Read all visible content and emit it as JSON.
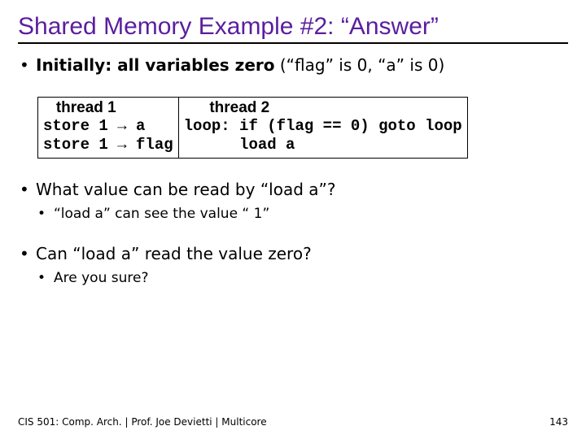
{
  "title": "Shared Memory Example #2: “Answer”",
  "bullets": {
    "b1_prefix_bold": "Initially: all variables zero",
    "b1_suffix": " (“flag” is 0, “a” is 0)",
    "b2": "What value can be read by “load a”?",
    "b2_sub": "“load a” can see the value “ 1”",
    "b3": "Can “load a” read the value zero?",
    "b3_sub": "Are you sure?"
  },
  "code": {
    "t1_head": "   thread 1",
    "t1_body": "store 1 → a\nstore 1 → flag",
    "t2_head": "      thread 2",
    "t2_body": "loop: if (flag == 0) goto loop\n      load a"
  },
  "footer": {
    "left": "CIS 501: Comp. Arch.  |  Prof. Joe Devietti  |  Multicore",
    "right": "143"
  }
}
